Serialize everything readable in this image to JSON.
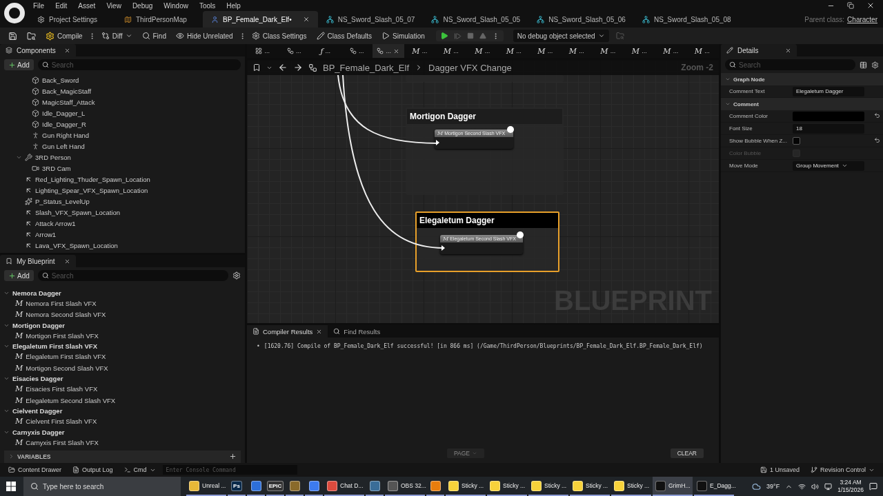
{
  "menu": [
    "File",
    "Edit",
    "Asset",
    "View",
    "Debug",
    "Window",
    "Tools",
    "Help"
  ],
  "document_tabs": [
    {
      "label": "Project Settings",
      "kind": "settings",
      "selected": false
    },
    {
      "label": "ThirdPersonMap",
      "kind": "map",
      "selected": false
    },
    {
      "label": "BP_Female_Dark_Elf•",
      "kind": "blueprint",
      "selected": true
    },
    {
      "label": "NS_Sword_Slash_05_07",
      "kind": "niagara",
      "selected": false
    },
    {
      "label": "NS_Sword_Slash_05_05",
      "kind": "niagara",
      "selected": false
    },
    {
      "label": "NS_Sword_Slash_05_06",
      "kind": "niagara",
      "selected": false
    },
    {
      "label": "NS_Sword_Slash_05_08",
      "kind": "niagara",
      "selected": false
    }
  ],
  "parent_class": {
    "label": "Parent class:",
    "value": "Character"
  },
  "toolbar": {
    "buttons": [
      {
        "kind": "save"
      },
      {
        "kind": "browse"
      },
      {
        "kind": "compile",
        "label": "Compile"
      },
      {
        "kind": "diff",
        "label": "Diff"
      },
      {
        "kind": "find",
        "label": "Find"
      },
      {
        "kind": "hide",
        "label": "Hide Unrelated"
      },
      {
        "kind": "class_settings",
        "label": "Class Settings"
      },
      {
        "kind": "class_defaults",
        "label": "Class Defaults"
      },
      {
        "kind": "simulation",
        "label": "Simulation"
      }
    ],
    "debug_select": "No debug object selected"
  },
  "components": {
    "title": "Components",
    "add": "Add",
    "search_placeholder": "Search",
    "items": [
      {
        "children": [
          {
            "label": "Back_Sword",
            "kind": "mesh"
          },
          {
            "label": "Back_MagicStaff",
            "kind": "mesh"
          },
          {
            "label": "MagicStaff_Attack",
            "kind": "mesh"
          },
          {
            "label": "Idle_Dagger_L",
            "kind": "mesh"
          },
          {
            "label": "Idle_Dagger_R",
            "kind": "mesh"
          },
          {
            "label": "Gun Right Hand",
            "kind": "skeletal"
          },
          {
            "label": "Gun Left Hand",
            "kind": "skeletal"
          }
        ]
      },
      {
        "label": "3RD Person",
        "kind": "arm",
        "expanded": true,
        "children": [
          {
            "label": "3RD Cam",
            "kind": "camera"
          }
        ]
      },
      {
        "label": "Red_Lighting_Thuder_Spawn_Location",
        "kind": "arrow"
      },
      {
        "label": "Lighting_Spear_VFX_Spawn_Location",
        "kind": "arrow"
      },
      {
        "label": "P_Status_LevelUp",
        "kind": "particle"
      },
      {
        "label": "Slash_VFX_Spawn_Location",
        "kind": "arrow"
      },
      {
        "label": "Attack Arrow1",
        "kind": "arrow"
      },
      {
        "label": "Arrow1",
        "kind": "arrow"
      },
      {
        "label": "Lava_VFX_Spawn_Location",
        "kind": "arrow"
      }
    ]
  },
  "my_blueprint": {
    "title": "My Blueprint",
    "add": "Add",
    "search_placeholder": "Search",
    "groups": [
      {
        "label": "Nemora Dagger",
        "expanded": true,
        "children": [
          {
            "glyph": "M",
            "label": "Nemora First Slash VFX"
          },
          {
            "glyph": "M",
            "label": "Nemora Second Slash VFX"
          }
        ]
      },
      {
        "label": "Mortigon Dagger",
        "expanded": true,
        "children": [
          {
            "glyph": "M",
            "label": "Mortigon First Slash VFX"
          }
        ]
      },
      {
        "label": "Elegaletum First Slash VFX",
        "expanded": true,
        "children": [
          {
            "glyph": "M",
            "label": "Elegaletum First Slash VFX"
          },
          {
            "glyph": "M",
            "label": "Mortigon Second Slash VFX"
          }
        ]
      },
      {
        "label": "Eisacies Dagger",
        "expanded": true,
        "children": [
          {
            "glyph": "M",
            "label": "Eisacies First Slash VFX"
          },
          {
            "glyph": "M",
            "label": "Elegaletum Second Slash VFX"
          }
        ]
      },
      {
        "label": "Cielvent Dagger",
        "expanded": true,
        "children": [
          {
            "glyph": "M",
            "label": "Cielvent First Slash VFX"
          }
        ]
      },
      {
        "label": "Carnyxis Dagger",
        "expanded": true,
        "children": [
          {
            "glyph": "M",
            "label": "Carnyxis First Slash VFX"
          }
        ]
      }
    ],
    "sections": [
      {
        "label": "VARIABLES",
        "expanded": false
      }
    ]
  },
  "graph_tabs": [
    {
      "kind": "grid",
      "label": "...",
      "selected": false
    },
    {
      "kind": "graph",
      "label": "...",
      "selected": false
    },
    {
      "kind": "function",
      "glyph": "ƒ",
      "label": "...",
      "selected": false
    },
    {
      "kind": "graph",
      "label": "...",
      "selected": false
    },
    {
      "kind": "graph",
      "label": "...",
      "selected": true
    },
    {
      "kind": "macro",
      "glyph": "M",
      "label": "...",
      "selected": false
    },
    {
      "kind": "macro",
      "glyph": "M",
      "label": "...",
      "selected": false
    },
    {
      "kind": "macro",
      "glyph": "M",
      "label": "...",
      "selected": false
    },
    {
      "kind": "macro",
      "glyph": "M",
      "label": "...",
      "selected": false
    },
    {
      "kind": "macro",
      "glyph": "M",
      "label": "...",
      "selected": false
    },
    {
      "kind": "macro",
      "glyph": "M",
      "label": "...",
      "selected": false
    },
    {
      "kind": "macro",
      "glyph": "M",
      "label": "...",
      "selected": false
    },
    {
      "kind": "macro",
      "glyph": "M",
      "label": "...",
      "selected": false
    },
    {
      "kind": "macro",
      "glyph": "M",
      "label": "...",
      "selected": false
    },
    {
      "kind": "macro",
      "glyph": "M",
      "label": "...",
      "selected": false
    }
  ],
  "breadcrumb": [
    "BP_Female_Dark_Elf",
    "Dagger VFX Change"
  ],
  "zoom": "Zoom -2",
  "graph_watermark": "BLUEPRINT",
  "comments": [
    {
      "title": "Mortigon Dagger",
      "selected": false,
      "node": {
        "glyph": "M",
        "label": "Mortigon Second Slash VFX"
      }
    },
    {
      "title": "Elegaletum Dagger",
      "selected": true,
      "node": {
        "glyph": "M",
        "label": "Elegaletum Second Slash VFX"
      }
    }
  ],
  "details": {
    "title": "Details",
    "search_placeholder": "Search",
    "sections": [
      {
        "title": "Graph Node",
        "expanded": true,
        "rows": [
          {
            "label": "Comment Text",
            "kind": "text",
            "value": "Elegaletum Dagger"
          }
        ]
      },
      {
        "title": "Comment",
        "expanded": true,
        "rows": [
          {
            "label": "Comment Color",
            "kind": "color",
            "color": "#000000",
            "reset": true
          },
          {
            "label": "Font Size",
            "kind": "text",
            "value": "18"
          },
          {
            "label": "Show Bubble When Z...",
            "kind": "checkbox",
            "checked": false,
            "disabled": false,
            "reset": true
          },
          {
            "label": "Color Bubble",
            "kind": "checkbox",
            "checked": false,
            "disabled": true
          },
          {
            "label": "Move Mode",
            "kind": "dropdown",
            "value": "Group Movement"
          }
        ]
      }
    ]
  },
  "results": {
    "tabs": [
      {
        "label": "Compiler Results",
        "selected": true
      },
      {
        "label": "Find Results",
        "selected": false
      }
    ],
    "messages": [
      {
        "bullet": "•",
        "text": "[1620.76] Compile of BP_Female_Dark_Elf successful! [in 866 ms] (/Game/ThirdPerson/Blueprints/BP_Female_Dark_Elf.BP_Female_Dark_Elf)"
      }
    ],
    "page_button": {
      "label": "PAGE",
      "disabled": true
    },
    "clear_button": "CLEAR"
  },
  "status_bar": {
    "content_drawer": "Content Drawer",
    "output_log": "Output Log",
    "cmd": "Cmd",
    "console_placeholder": "Enter Console Command",
    "unsaved": "1 Unsaved",
    "revision_control": "Revision Control"
  },
  "taskbar": {
    "search_placeholder": "Type here to search",
    "apps": [
      {
        "kind": "folder",
        "label": "Unreal ...",
        "selected": false
      },
      {
        "kind": "photoshop",
        "glyph": "Ps",
        "selected": false
      },
      {
        "kind": "blue",
        "selected": false
      },
      {
        "kind": "epic",
        "glyph": "EPIC",
        "selected": false
      },
      {
        "kind": "fruit",
        "selected": false
      },
      {
        "kind": "gcircle",
        "selected": false
      },
      {
        "kind": "chrome",
        "label": "Chat D...",
        "selected": false
      },
      {
        "kind": "steam",
        "selected": false
      },
      {
        "kind": "obs",
        "label": "OBS 32...",
        "selected": false
      },
      {
        "kind": "blender",
        "selected": false
      },
      {
        "kind": "sticky",
        "label": "Sticky ...",
        "selected": false
      },
      {
        "kind": "sticky",
        "label": "Sticky ...",
        "selected": false
      },
      {
        "kind": "sticky",
        "label": "Sticky ...",
        "selected": false
      },
      {
        "kind": "sticky",
        "label": "Sticky ...",
        "selected": false
      },
      {
        "kind": "sticky",
        "label": "Sticky ...",
        "selected": false
      },
      {
        "kind": "unreal",
        "label": "GrimH...",
        "selected": true
      },
      {
        "kind": "unreal",
        "label": "E_Dagg...",
        "selected": false
      }
    ],
    "weather": "39°F",
    "time": "3:24 AM",
    "date": "1/15/2026"
  }
}
